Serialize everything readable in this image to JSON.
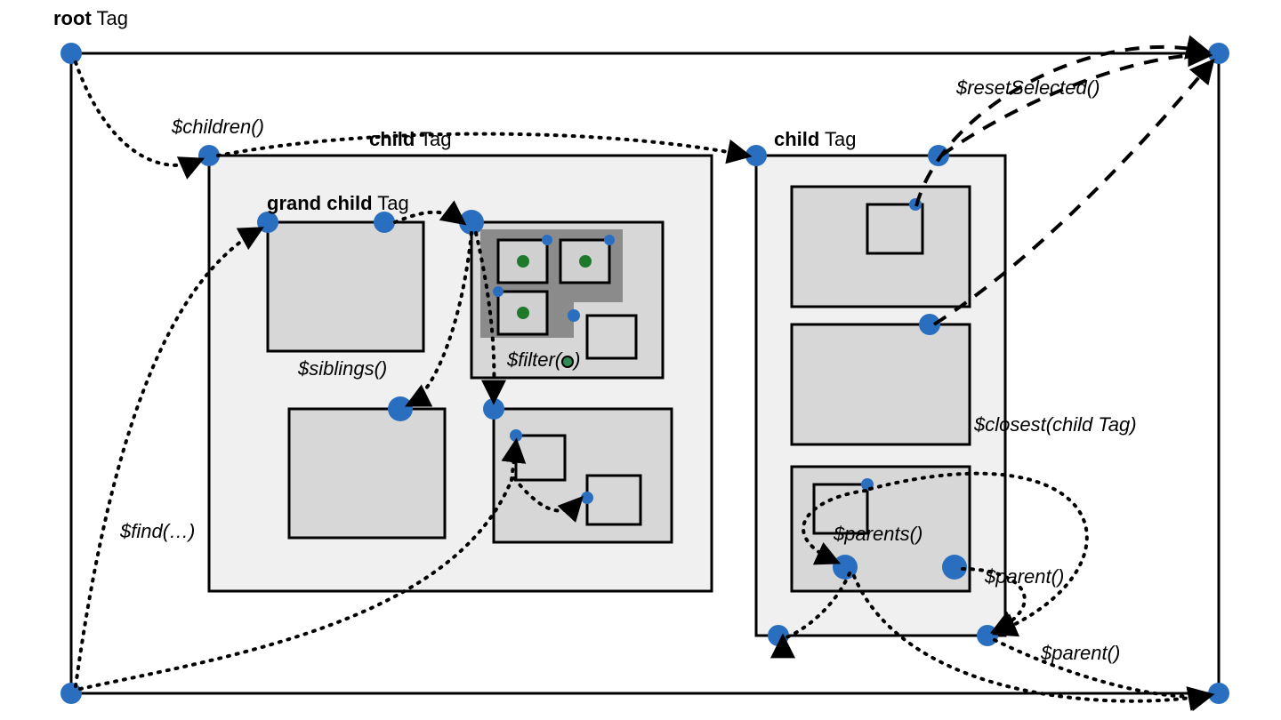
{
  "labels": {
    "root": {
      "bold": "root",
      "suffix": " Tag"
    },
    "child1": {
      "bold": "child",
      "suffix": " Tag"
    },
    "child2": {
      "bold": "child",
      "suffix": " Tag"
    },
    "grandchild": {
      "bold": "grand child",
      "suffix": " Tag"
    }
  },
  "methods": {
    "children": "$children()",
    "find": "$find(…)",
    "siblings": "$siblings()",
    "filterPrefix": "$filter(",
    "filterSuffix": ")",
    "parents": "$parents()",
    "parent1": "$parent()",
    "parent2": "$parent()",
    "closest": "$closest(child Tag)",
    "resetSelected": "$resetSelected()"
  },
  "colors": {
    "node": "#2a6fbf",
    "nodeStroke": "#1f5a9a",
    "boxFill": "#f0f0f0",
    "innerFill": "#d7d7d7",
    "darkFill": "#838383",
    "greenDot": "#1e7a2a",
    "line": "#000"
  }
}
